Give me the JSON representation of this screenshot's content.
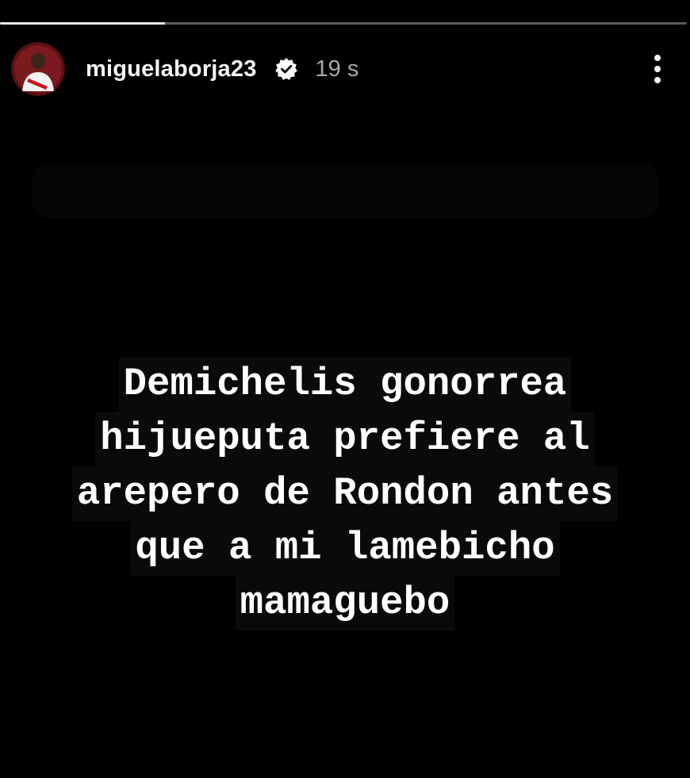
{
  "story": {
    "progress": 0.24,
    "user": {
      "username": "miguelaborja23",
      "verified": true,
      "avatar_icon": "profile-avatar",
      "timestamp": "19 s"
    },
    "more_icon": "more-vertical-icon",
    "text_lines": [
      "Demichelis gonorrea",
      "hijueputa prefiere al",
      "arepero de Rondon antes",
      "que a mi lamebicho",
      "mamaguebo"
    ]
  },
  "colors": {
    "background": "#000000",
    "text": "#ffffff",
    "muted": "#a8a8a8",
    "avatar_bg": "#5a0f12"
  }
}
